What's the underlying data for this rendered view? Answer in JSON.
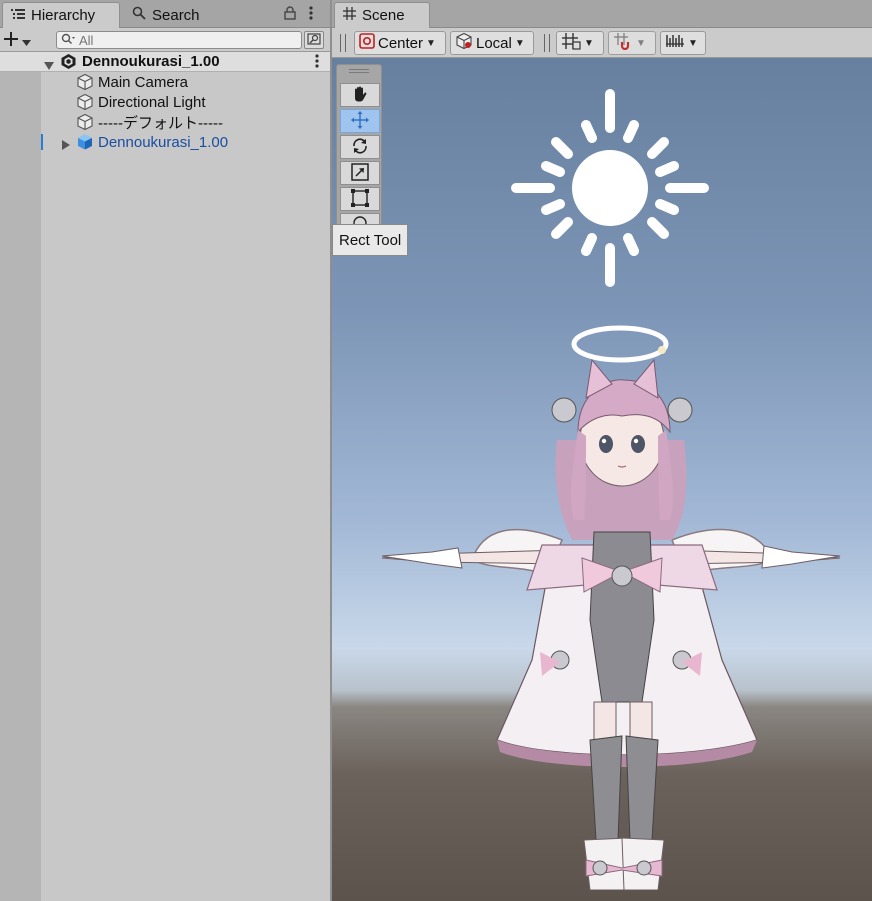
{
  "hierarchy": {
    "tab_label": "Hierarchy",
    "search_tab_label": "Search",
    "search_placeholder": "All",
    "scene_name": "Dennoukurasi_1.00",
    "objects": [
      {
        "label": "Main Camera"
      },
      {
        "label": "Directional Light"
      },
      {
        "label": "-----デフォルト-----"
      },
      {
        "label": "Dennoukurasi_1.00"
      }
    ]
  },
  "scene": {
    "tab_label": "Scene",
    "pivot_label": "Center",
    "space_label": "Local",
    "tooltip": "Rect Tool"
  },
  "colors": {
    "prefab_text": "#1a4ea3",
    "selected_tool": "#9fc4ef",
    "sky_top": "#67809f",
    "ground": "#5b534c"
  }
}
